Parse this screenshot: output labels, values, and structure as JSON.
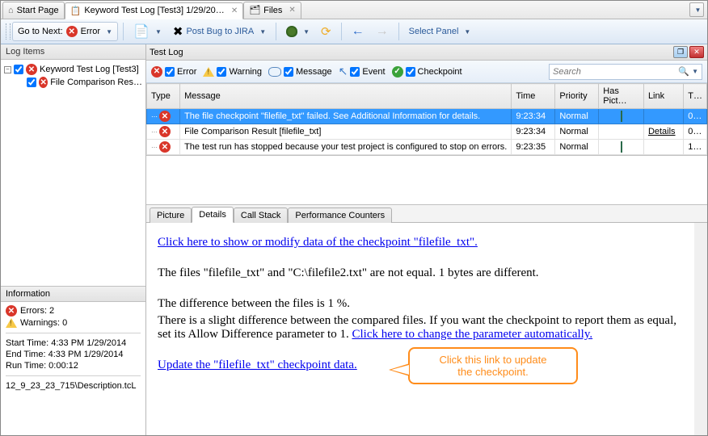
{
  "tabs": {
    "start": "Start Page",
    "active": "Keyword Test Log [Test3] 1/29/20…",
    "files": "Files"
  },
  "toolbar": {
    "goto_next": "Go to Next:",
    "error": "Error",
    "post_bug": "Post Bug to JIRA",
    "select_panel": "Select Panel"
  },
  "left": {
    "log_items_header": "Log Items",
    "root": "Keyword Test Log [Test3]",
    "child": "File Comparison Res…",
    "info_header": "Information",
    "errors_label": "Errors: 2",
    "warnings_label": "Warnings: 0",
    "start_time": "Start Time:  4:33 PM 1/29/2014",
    "end_time": "End Time:  4:33 PM 1/29/2014",
    "run_time": "Run Time:  0:00:12",
    "file_ref": "12_9_23_23_715\\Description.tcL"
  },
  "right": {
    "header": "Test Log",
    "filters": {
      "error": "Error",
      "warning": "Warning",
      "message": "Message",
      "event": "Event",
      "checkpoint": "Checkpoint",
      "search_placeholder": "Search"
    },
    "columns": {
      "type": "Type",
      "message": "Message",
      "time": "Time",
      "priority": "Priority",
      "has_pic": "Has Pict…",
      "link": "Link",
      "t": "T…"
    },
    "rows": [
      {
        "msg": "The file checkpoint \"filefile_txt\" failed. See Additional Information for details.",
        "time": "9:23:34",
        "priority": "Normal",
        "pic": true,
        "link": "",
        "t": "0…"
      },
      {
        "msg": "File Comparison Result [filefile_txt]",
        "time": "9:23:34",
        "priority": "Normal",
        "pic": false,
        "link": "Details",
        "t": "0…"
      },
      {
        "msg": "The test run has stopped because your test project is configured to stop on errors.",
        "time": "9:23:35",
        "priority": "Normal",
        "pic": true,
        "link": "",
        "t": "1…"
      }
    ]
  },
  "detail_tabs": {
    "picture": "Picture",
    "details": "Details",
    "callstack": "Call Stack",
    "perf": "Performance Counters"
  },
  "details": {
    "link1": "Click here to show or modify data of the checkpoint \"filefile_txt\".",
    "p1": "The files \"filefile_txt\" and \"C:\\filefile2.txt\" are not equal. 1 bytes are different.",
    "p2": "The difference between the files is 1 %.",
    "p3a": "There is a slight difference between the compared files. If you want the checkpoint to report them as equal, set its Allow Difference parameter to 1. ",
    "link2": "Click here to change the parameter automatically.",
    "link3": "Update the \"filefile_txt\" checkpoint data.",
    "callout_l1": "Click this link to update",
    "callout_l2": "the checkpoint."
  }
}
